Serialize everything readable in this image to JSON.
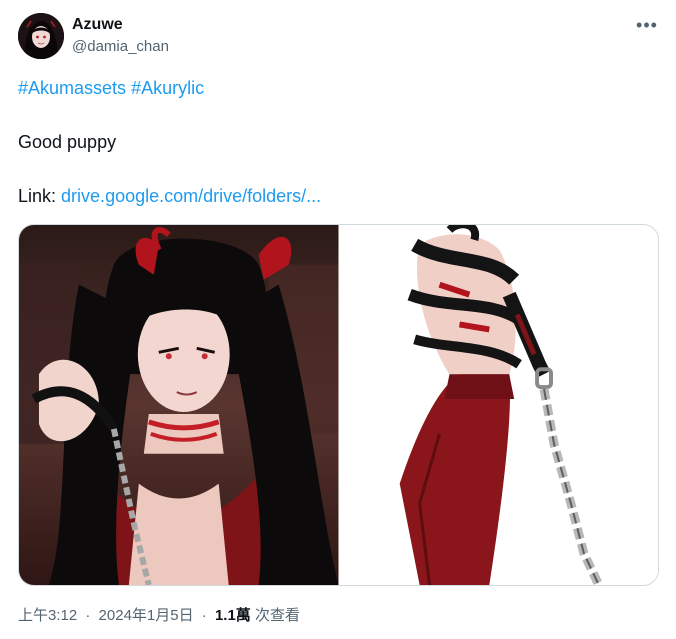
{
  "author": {
    "display_name": "Azuwe",
    "handle": "@damia_chan"
  },
  "tweet": {
    "hashtags": [
      "#Akumassets",
      "#Akurylic"
    ],
    "text": "Good puppy",
    "link_label": "Link:",
    "link_text": "drive.google.com/drive/folders/..."
  },
  "media": [
    {
      "description": "Illustrated character with long black hair and red horns, holding a chain leash"
    },
    {
      "description": "Close-up of a hand in a red sleeve gripping a leash with a silver chain"
    }
  ],
  "meta": {
    "time": "上午3:12",
    "date": "2024年1月5日",
    "views_count": "1.1萬",
    "views_label": "次查看"
  },
  "icons": {
    "more": "more-horizontal-icon"
  },
  "colors": {
    "link": "#1d9bf0",
    "secondary_text": "#536471",
    "primary_text": "#0f1419",
    "border": "#cfd9de"
  }
}
